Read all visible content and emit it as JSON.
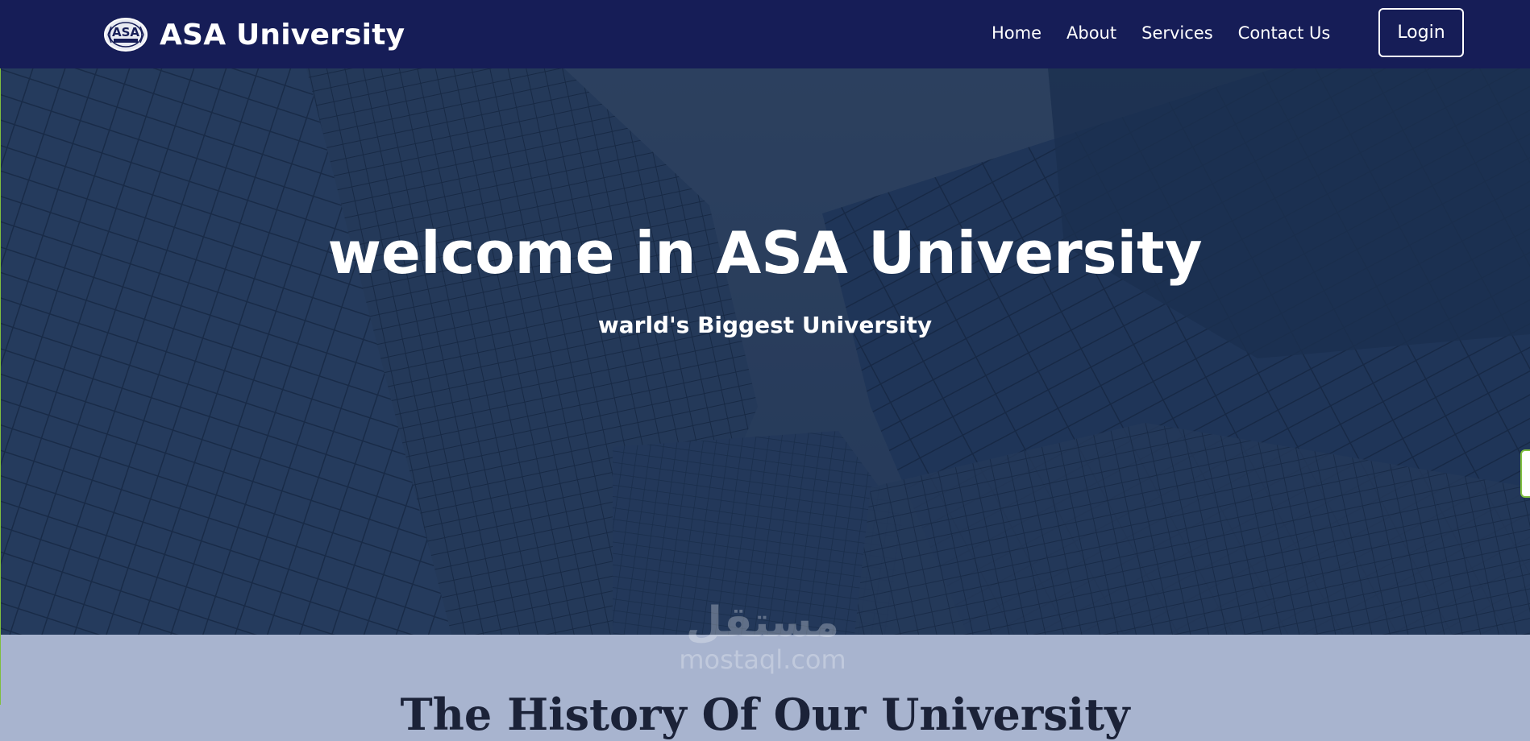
{
  "navbar": {
    "brand": {
      "logo_icon": "asa-college-seal-icon",
      "logo_text": "ASA",
      "name": "ASA University"
    },
    "links": [
      {
        "label": "Home"
      },
      {
        "label": "About"
      },
      {
        "label": "Services"
      },
      {
        "label": "Contact Us"
      }
    ],
    "login_label": "Login"
  },
  "hero": {
    "title": "welcome in ASA University",
    "subtitle": "warld's Biggest University",
    "background": "skyscrapers-photo"
  },
  "history": {
    "title": "The History Of Our University"
  },
  "watermark": {
    "arabic": "مستقل",
    "latin": "mostaql.com"
  },
  "colors": {
    "navbar": "#161d57",
    "hero_overlay": "#1d3557",
    "section_bg": "#a8b4cf",
    "text": "#ffffff"
  }
}
